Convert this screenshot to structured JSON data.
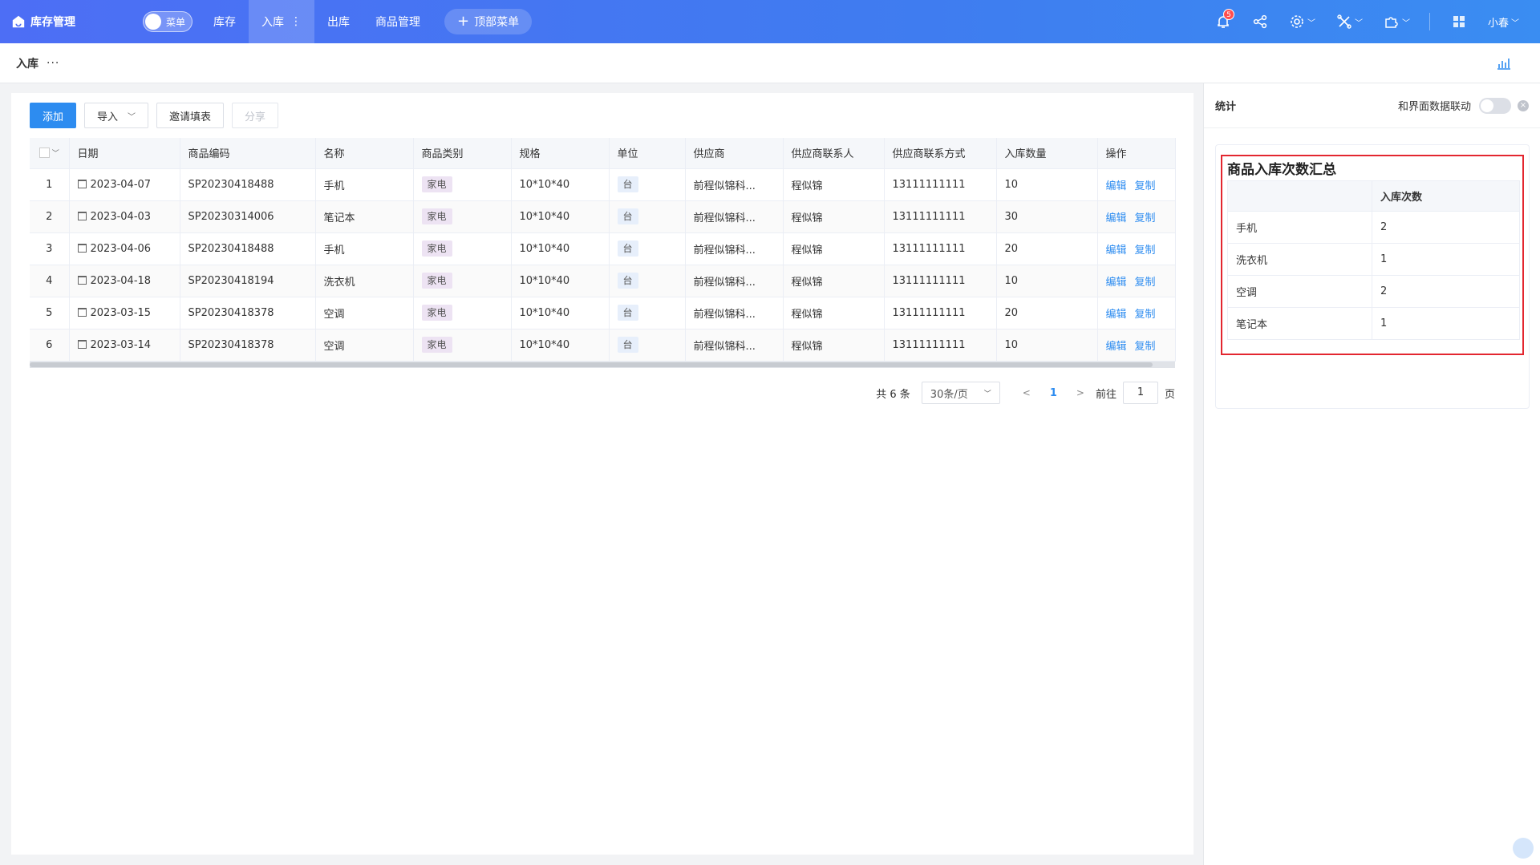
{
  "app": {
    "title": "库存管理"
  },
  "top": {
    "menu_toggle_label": "菜单",
    "navs": [
      "库存",
      "入库",
      "出库",
      "商品管理"
    ],
    "active_nav": 1,
    "top_menu_label": "顶部菜单",
    "notification_count": "5",
    "user_name": "小春"
  },
  "breadcrumb": {
    "current": "入库",
    "more": "···"
  },
  "toolbar": {
    "add": "添加",
    "import": "导入",
    "invite": "邀请填表",
    "share": "分享"
  },
  "table": {
    "columns": [
      "日期",
      "商品编码",
      "名称",
      "商品类别",
      "规格",
      "单位",
      "供应商",
      "供应商联系人",
      "供应商联系方式",
      "入库数量",
      "操作"
    ],
    "rows": [
      {
        "no": "1",
        "date": "2023-04-07",
        "code": "SP20230418488",
        "name": "手机",
        "category": "家电",
        "spec": "10*10*40",
        "unit": "台",
        "supplier": "前程似锦科...",
        "contact": "程似锦",
        "phone": "13111111111",
        "qty": "10"
      },
      {
        "no": "2",
        "date": "2023-04-03",
        "code": "SP20230314006",
        "name": "笔记本",
        "category": "家电",
        "spec": "10*10*40",
        "unit": "台",
        "supplier": "前程似锦科...",
        "contact": "程似锦",
        "phone": "13111111111",
        "qty": "30"
      },
      {
        "no": "3",
        "date": "2023-04-06",
        "code": "SP20230418488",
        "name": "手机",
        "category": "家电",
        "spec": "10*10*40",
        "unit": "台",
        "supplier": "前程似锦科...",
        "contact": "程似锦",
        "phone": "13111111111",
        "qty": "20"
      },
      {
        "no": "4",
        "date": "2023-04-18",
        "code": "SP20230418194",
        "name": "洗衣机",
        "category": "家电",
        "spec": "10*10*40",
        "unit": "台",
        "supplier": "前程似锦科...",
        "contact": "程似锦",
        "phone": "13111111111",
        "qty": "10"
      },
      {
        "no": "5",
        "date": "2023-03-15",
        "code": "SP20230418378",
        "name": "空调",
        "category": "家电",
        "spec": "10*10*40",
        "unit": "台",
        "supplier": "前程似锦科...",
        "contact": "程似锦",
        "phone": "13111111111",
        "qty": "20"
      },
      {
        "no": "6",
        "date": "2023-03-14",
        "code": "SP20230418378",
        "name": "空调",
        "category": "家电",
        "spec": "10*10*40",
        "unit": "台",
        "supplier": "前程似锦科...",
        "contact": "程似锦",
        "phone": "13111111111",
        "qty": "10"
      }
    ],
    "actions": {
      "edit": "编辑",
      "copy": "复制"
    }
  },
  "pager": {
    "total": "共 6 条",
    "page_size": "30条/页",
    "current": "1",
    "goto_label": "前往",
    "goto_value": "1",
    "page_suffix": "页"
  },
  "side": {
    "title": "统计",
    "sync_label": "和界面数据联动",
    "sync_on": false,
    "card_title": "商品入库次数汇总",
    "summary": {
      "header": [
        "",
        "入库次数"
      ],
      "rows": [
        {
          "name": "手机",
          "count": "2"
        },
        {
          "name": "洗衣机",
          "count": "1"
        },
        {
          "name": "空调",
          "count": "2"
        },
        {
          "name": "笔记本",
          "count": "1"
        }
      ]
    },
    "highlight_color": "#e3262f"
  },
  "colors": {
    "accent": "#2d8cf0",
    "topbar": "#4d6ef5"
  }
}
